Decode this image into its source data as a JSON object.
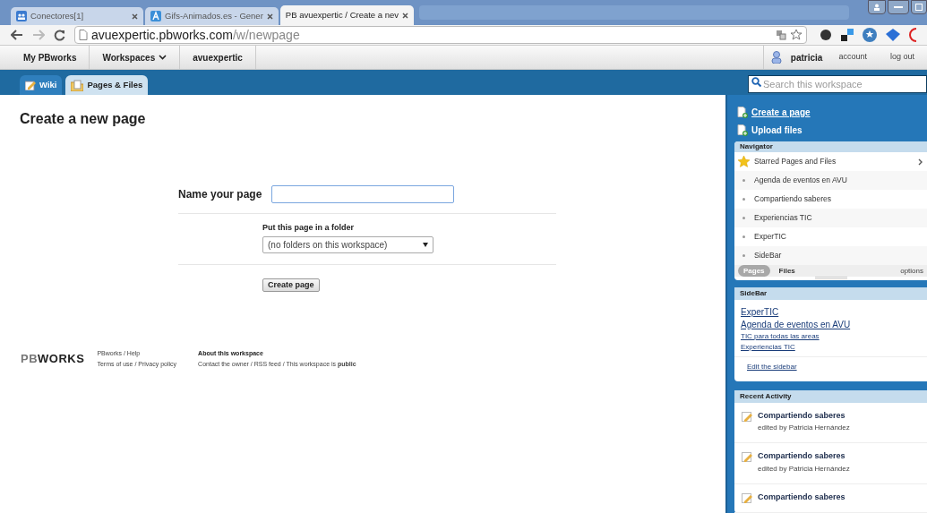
{
  "browser": {
    "tabs": [
      {
        "title": "Conectores[1]",
        "selected": false
      },
      {
        "title": "Gifs-Animados.es - Gener",
        "selected": false
      },
      {
        "title": "PB avuexpertic / Create a nev",
        "selected": true
      }
    ],
    "url_host": "avuexpertic.pbworks.com",
    "url_path": "/w/newpage"
  },
  "topnav": {
    "crumbs": [
      {
        "label": "My PBworks",
        "dropdown": false
      },
      {
        "label": "Workspaces",
        "dropdown": true
      },
      {
        "label": "avuexpertic",
        "dropdown": false
      }
    ],
    "user": "patricia",
    "links": [
      "account",
      "log out"
    ]
  },
  "wiki_tabs": [
    {
      "label": "Wiki",
      "selected": false
    },
    {
      "label": "Pages & Files",
      "selected": true
    }
  ],
  "search": {
    "placeholder": "Search this workspace"
  },
  "page": {
    "title": "Create a new page",
    "name_label": "Name your page",
    "folder_label": "Put this page in a folder",
    "folder_value": "(no folders on this workspace)",
    "button": "Create page"
  },
  "footer": {
    "logo_light": "PB",
    "logo_dark": "WORKS",
    "col1": [
      "PBworks / Help",
      "Terms of use / Privacy policy"
    ],
    "col2_title": "About this workspace",
    "col2_text": "Contact the owner / RSS feed / This workspace is **public**"
  },
  "sidebar": {
    "actions": [
      "Create a page",
      "Upload files"
    ],
    "navigator": {
      "title": "Navigator",
      "items": [
        {
          "label": "Starred Pages and Files",
          "kind": "starred"
        },
        {
          "label": "Agenda de eventos en AVU",
          "kind": "page"
        },
        {
          "label": "Compartiendo saberes",
          "kind": "page"
        },
        {
          "label": "Experiencias TIC",
          "kind": "page"
        },
        {
          "label": "ExperTIC",
          "kind": "page"
        },
        {
          "label": "SideBar",
          "kind": "page"
        }
      ],
      "tabs": [
        {
          "label": "Pages",
          "selected": true
        },
        {
          "label": "Files",
          "selected": false
        }
      ],
      "options": "options"
    },
    "sidebar_panel": {
      "title": "SideBar",
      "links": [
        {
          "label": "ExperTIC",
          "kind": "large"
        },
        {
          "label": "Agenda de eventos en AVU",
          "kind": "large"
        },
        {
          "label": "TIC para todas las areas",
          "kind": "small"
        },
        {
          "label": "Experiencias TIC",
          "kind": "small"
        }
      ],
      "edit": "Edit the sidebar"
    },
    "recent": {
      "title": "Recent Activity",
      "items": [
        {
          "title": "Compartiendo saberes",
          "detail": "edited by Patricia Hernández"
        },
        {
          "title": "Compartiendo saberes",
          "detail": "edited by Patricia Hernández"
        },
        {
          "title": "Compartiendo saberes"
        }
      ]
    }
  }
}
